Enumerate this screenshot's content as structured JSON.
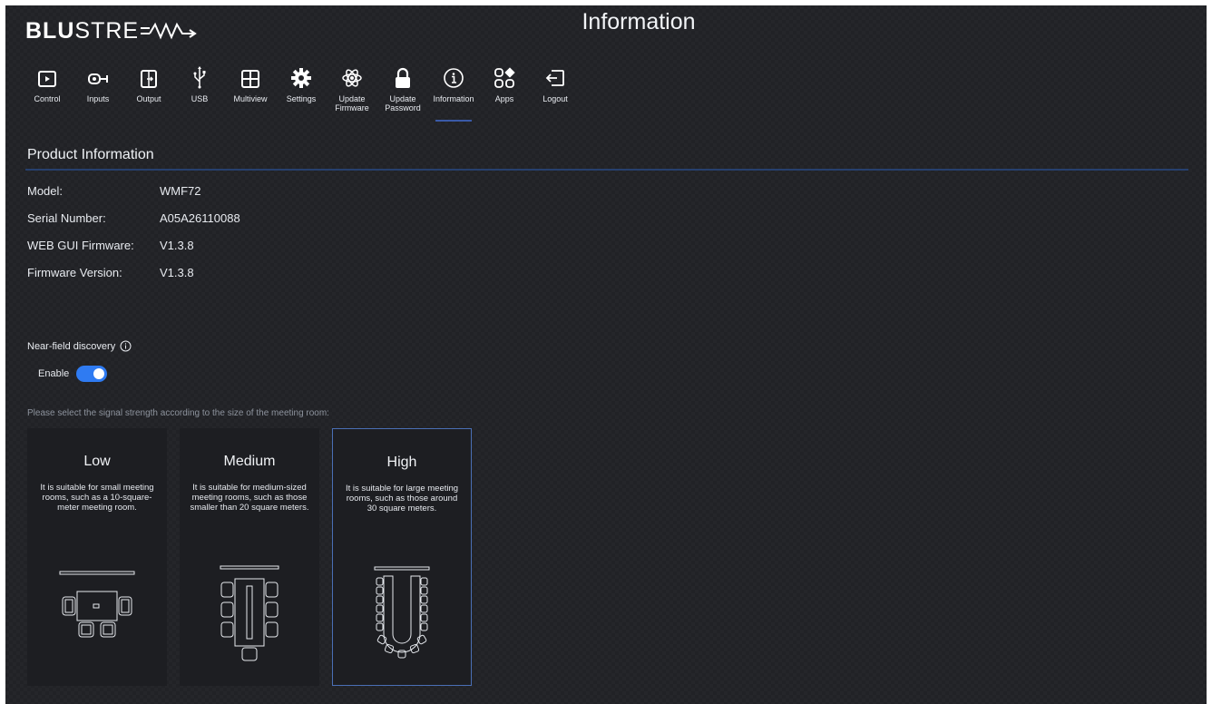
{
  "header": {
    "logo_bold": "BLU",
    "logo_rest": "STRE",
    "title": "Information"
  },
  "nav": {
    "items": [
      {
        "label": "Control",
        "icon": "play-icon"
      },
      {
        "label": "Inputs",
        "icon": "input-icon"
      },
      {
        "label": "Output",
        "icon": "output-icon"
      },
      {
        "label": "USB",
        "icon": "usb-icon"
      },
      {
        "label": "Multiview",
        "icon": "grid-icon"
      },
      {
        "label": "Settings",
        "icon": "gear-icon"
      },
      {
        "label": "Update\nFirmware",
        "icon": "atom-icon"
      },
      {
        "label": "Update\nPassword",
        "icon": "lock-icon"
      },
      {
        "label": "Information",
        "icon": "info-icon"
      },
      {
        "label": "Apps",
        "icon": "apps-icon"
      },
      {
        "label": "Logout",
        "icon": "logout-icon"
      }
    ],
    "active": "Information"
  },
  "product": {
    "title": "Product Information",
    "rows": [
      {
        "key": "Model:",
        "value": "WMF72"
      },
      {
        "key": "Serial Number:",
        "value": "A05A26110088"
      },
      {
        "key": "WEB GUI Firmware:",
        "value": "V1.3.8"
      },
      {
        "key": "Firmware Version:",
        "value": "V1.3.8"
      }
    ]
  },
  "nfc": {
    "title": "Near-field discovery",
    "enable_label": "Enable",
    "enabled": true,
    "hint": "Please select the signal strength according to the size of the meeting room:"
  },
  "strength": {
    "selected": "High",
    "cards": [
      {
        "title": "Low",
        "desc": "It is suitable for small meeting rooms, such as a 10-square-meter meeting room."
      },
      {
        "title": "Medium",
        "desc": "It is suitable for medium-sized meeting rooms, such as those smaller than 20 square meters."
      },
      {
        "title": "High",
        "desc": "It is suitable for large meeting rooms, such as those around 30 square meters."
      }
    ]
  },
  "colors": {
    "background": "#212226",
    "accent": "#2f7bf2",
    "rule": "#27406e",
    "selected_border": "#4a6fb5"
  }
}
